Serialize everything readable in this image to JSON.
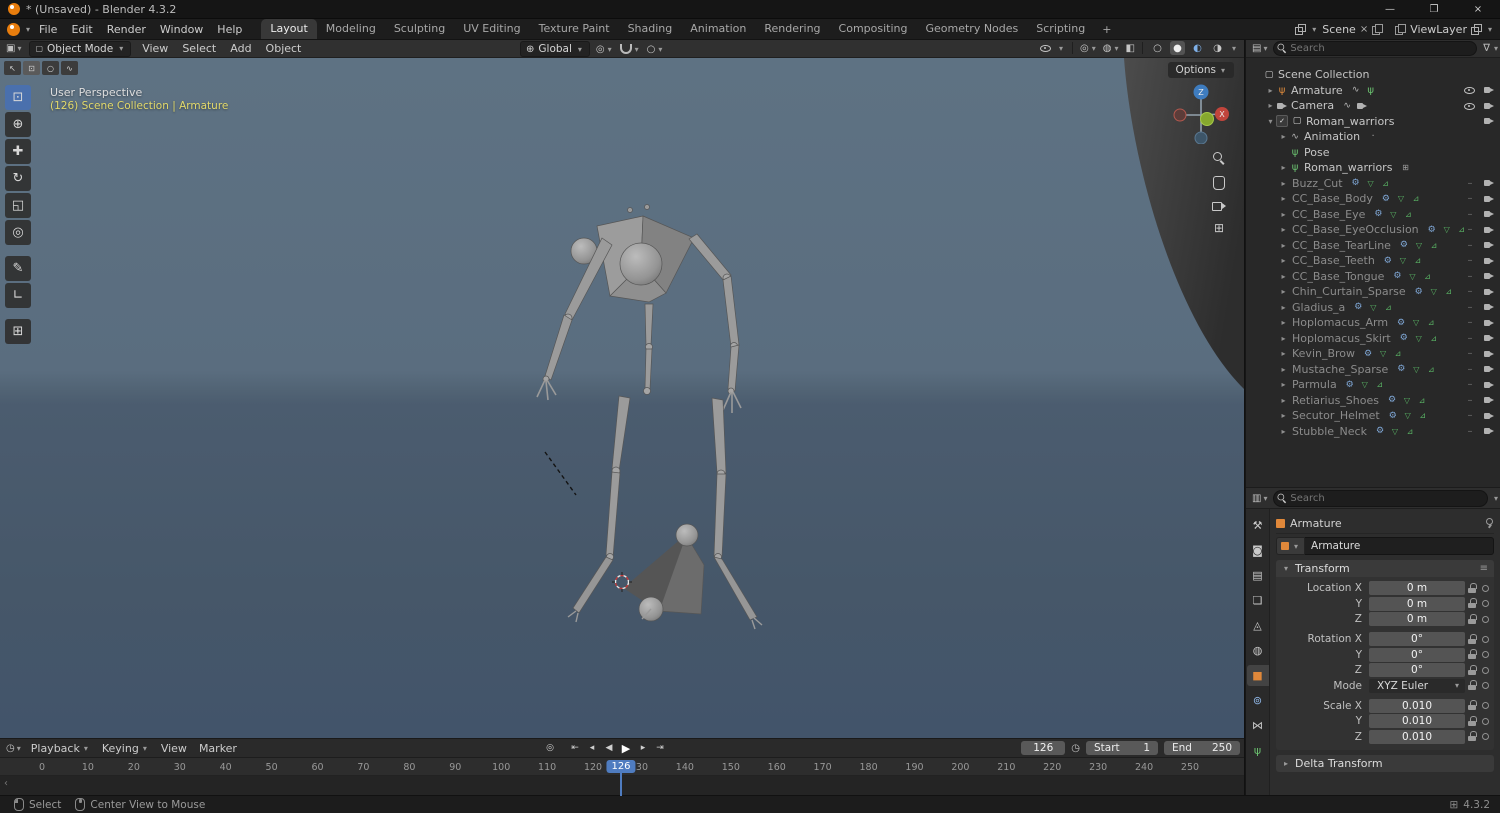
{
  "window": {
    "title": "* (Unsaved) - Blender 4.3.2"
  },
  "titlebar_buttons": [
    {
      "name": "minimize",
      "glyph": "—"
    },
    {
      "name": "maximize",
      "glyph": "❐"
    },
    {
      "name": "close",
      "glyph": "×"
    }
  ],
  "topbar": {
    "menus": [
      "File",
      "Edit",
      "Render",
      "Window",
      "Help"
    ],
    "workspaces": [
      "Layout",
      "Modeling",
      "Sculpting",
      "UV Editing",
      "Texture Paint",
      "Shading",
      "Animation",
      "Rendering",
      "Compositing",
      "Geometry Nodes",
      "Scripting"
    ],
    "active_workspace": "Layout",
    "add_tab": "+",
    "scene_label": "Scene",
    "viewlayer_label": "ViewLayer"
  },
  "vp_header": {
    "mode_label": "Object Mode",
    "menus": [
      "View",
      "Select",
      "Add",
      "Object"
    ],
    "orientation_label": "Global"
  },
  "viewport": {
    "persp_label": "User Perspective",
    "context_label": "(126) Scene Collection | Armature",
    "options_label": "Options",
    "gizmo_z": "Z",
    "gizmo_x": "X"
  },
  "tools": [
    {
      "name": "select-box",
      "glyph": "⊡",
      "active": true
    },
    {
      "name": "cursor",
      "glyph": "⊕"
    },
    {
      "name": "move",
      "glyph": "✚"
    },
    {
      "name": "rotate",
      "glyph": "↻"
    },
    {
      "name": "scale",
      "glyph": "◱"
    },
    {
      "name": "transform",
      "glyph": "◎"
    },
    {
      "name": "annotate",
      "glyph": "✎"
    },
    {
      "name": "measure",
      "glyph": "∟"
    },
    {
      "name": "add-cube",
      "glyph": "⊞"
    }
  ],
  "select_modes": [
    {
      "name": "tweak",
      "glyph": "↖"
    },
    {
      "name": "select-box",
      "glyph": "⊡",
      "active": true
    },
    {
      "name": "select-circle",
      "glyph": "○"
    },
    {
      "name": "select-lasso",
      "glyph": "∿"
    }
  ],
  "icon_glyphs": {
    "collection": "▢",
    "armature": "ψ",
    "armature-g": "ψ",
    "pose": "ψ",
    "action": "∿",
    "modifier": "⚙",
    "mesh": "▽",
    "vgroup": "⊿",
    "dash": "–",
    "dot": "·",
    "grid": "⊞",
    "check": "✓"
  },
  "icons": {
    "chev": "▾",
    "arrow_r": "▸",
    "burger": "≡",
    "funnel": "∇",
    "editor_outliner": "▤",
    "editor_props": "▥",
    "editor_3d": "▣",
    "editor_timeline": "◷",
    "globe": "⊕",
    "pivot": "◎",
    "prop_circle": "○",
    "vis_gizmo": "◎",
    "vis_overlay": "◍",
    "xray": "◧",
    "shade_wire": "○",
    "shade_solid": "●",
    "shade_mat": "◐",
    "shade_render": "◑",
    "scroll_left": "‹",
    "grid": "⊞",
    "obj_sq": "▢",
    "clock": "◷",
    "unlink": "×"
  },
  "outliner": {
    "search_placeholder": "Search",
    "rows": [
      {
        "label": "Scene Collection",
        "depth": 0,
        "icon": "collection",
        "arrow": ""
      },
      {
        "label": "Armature",
        "depth": 1,
        "icon": "armature",
        "arrow": "right",
        "after": [
          "action",
          "pose"
        ],
        "right": [
          "eye",
          "cam"
        ]
      },
      {
        "label": "Camera",
        "depth": 1,
        "icon": "cam",
        "arrow": "right",
        "after": [
          "action",
          "cam"
        ],
        "right": [
          "eye",
          "cam"
        ]
      },
      {
        "label": "Roman_warriors",
        "depth": 1,
        "icon": "collection",
        "arrow": "down",
        "checkbox": true,
        "right": [
          "cam"
        ]
      },
      {
        "label": "Animation",
        "depth": 2,
        "icon": "action",
        "arrow": "right",
        "after": [
          "dot"
        ]
      },
      {
        "label": "Pose",
        "depth": 2,
        "icon": "pose",
        "arrow": ""
      },
      {
        "label": "Roman_warriors",
        "depth": 2,
        "icon": "armature-g",
        "arrow": "right",
        "after": [
          "grid"
        ]
      },
      {
        "label": "Buzz_Cut",
        "depth": 2,
        "arrow": "right",
        "after": [
          "modifier",
          "mesh",
          "vgroup"
        ],
        "right": [
          "dash",
          "cam"
        ],
        "dim": true
      },
      {
        "label": "CC_Base_Body",
        "depth": 2,
        "arrow": "right",
        "after": [
          "modifier",
          "mesh",
          "vgroup"
        ],
        "right": [
          "dash",
          "cam"
        ],
        "dim": true
      },
      {
        "label": "CC_Base_Eye",
        "depth": 2,
        "arrow": "right",
        "after": [
          "modifier",
          "mesh",
          "vgroup"
        ],
        "right": [
          "dash",
          "cam"
        ],
        "dim": true
      },
      {
        "label": "CC_Base_EyeOcclusion",
        "depth": 2,
        "arrow": "right",
        "after": [
          "modifier",
          "mesh",
          "vgroup"
        ],
        "right": [
          "dash",
          "cam"
        ],
        "dim": true
      },
      {
        "label": "CC_Base_TearLine",
        "depth": 2,
        "arrow": "right",
        "after": [
          "modifier",
          "mesh",
          "vgroup"
        ],
        "right": [
          "dash",
          "cam"
        ],
        "dim": true
      },
      {
        "label": "CC_Base_Teeth",
        "depth": 2,
        "arrow": "right",
        "after": [
          "modifier",
          "mesh",
          "vgroup"
        ],
        "right": [
          "dash",
          "cam"
        ],
        "dim": true
      },
      {
        "label": "CC_Base_Tongue",
        "depth": 2,
        "arrow": "right",
        "after": [
          "modifier",
          "mesh",
          "vgroup"
        ],
        "right": [
          "dash",
          "cam"
        ],
        "dim": true
      },
      {
        "label": "Chin_Curtain_Sparse",
        "depth": 2,
        "arrow": "right",
        "after": [
          "modifier",
          "mesh",
          "vgroup"
        ],
        "right": [
          "dash",
          "cam"
        ],
        "dim": true
      },
      {
        "label": "Gladius_a",
        "depth": 2,
        "arrow": "right",
        "after": [
          "modifier",
          "mesh",
          "vgroup"
        ],
        "right": [
          "dash",
          "cam"
        ],
        "dim": true
      },
      {
        "label": "Hoplomacus_Arm",
        "depth": 2,
        "arrow": "right",
        "after": [
          "modifier",
          "mesh",
          "vgroup"
        ],
        "right": [
          "dash",
          "cam"
        ],
        "dim": true
      },
      {
        "label": "Hoplomacus_Skirt",
        "depth": 2,
        "arrow": "right",
        "after": [
          "modifier",
          "mesh",
          "vgroup"
        ],
        "right": [
          "dash",
          "cam"
        ],
        "dim": true
      },
      {
        "label": "Kevin_Brow",
        "depth": 2,
        "arrow": "right",
        "after": [
          "modifier",
          "mesh",
          "vgroup"
        ],
        "right": [
          "dash",
          "cam"
        ],
        "dim": true
      },
      {
        "label": "Mustache_Sparse",
        "depth": 2,
        "arrow": "right",
        "after": [
          "modifier",
          "mesh",
          "vgroup"
        ],
        "right": [
          "dash",
          "cam"
        ],
        "dim": true
      },
      {
        "label": "Parmula",
        "depth": 2,
        "arrow": "right",
        "after": [
          "modifier",
          "mesh",
          "vgroup"
        ],
        "right": [
          "dash",
          "cam"
        ],
        "dim": true
      },
      {
        "label": "Retiarius_Shoes",
        "depth": 2,
        "arrow": "right",
        "after": [
          "modifier",
          "mesh",
          "vgroup"
        ],
        "right": [
          "dash",
          "cam"
        ],
        "dim": true
      },
      {
        "label": "Secutor_Helmet",
        "depth": 2,
        "arrow": "right",
        "after": [
          "modifier",
          "mesh",
          "vgroup"
        ],
        "right": [
          "dash",
          "cam"
        ],
        "dim": true
      },
      {
        "label": "Stubble_Neck",
        "depth": 2,
        "arrow": "right",
        "after": [
          "modifier",
          "mesh",
          "vgroup"
        ],
        "right": [
          "dash",
          "cam"
        ],
        "dim": true
      }
    ]
  },
  "properties": {
    "search_placeholder": "Search",
    "breadcrumb_object": "Armature",
    "name_value": "Armature",
    "tabs": [
      {
        "name": "tool",
        "glyph": "⚒"
      },
      {
        "name": "render",
        "glyph": "◙"
      },
      {
        "name": "output",
        "glyph": "▤"
      },
      {
        "name": "view-layer",
        "glyph": "❏"
      },
      {
        "name": "scene",
        "glyph": "◬"
      },
      {
        "name": "world",
        "glyph": "◍"
      },
      {
        "name": "object",
        "glyph": "■",
        "active": true,
        "color": "#e0883a"
      },
      {
        "name": "physics",
        "glyph": "⊚",
        "color": "#8fb6e6"
      },
      {
        "name": "constraints",
        "glyph": "⋈"
      },
      {
        "name": "object-data",
        "glyph": "ψ",
        "color": "#6ac06f"
      }
    ],
    "transform": {
      "title": "Transform",
      "rows": [
        {
          "label": "Location X",
          "value": "0 m",
          "group": 1
        },
        {
          "label": "Y",
          "value": "0 m",
          "group": 1
        },
        {
          "label": "Z",
          "value": "0 m",
          "group": 1
        },
        {
          "label": "Rotation X",
          "value": "0°",
          "group": 2
        },
        {
          "label": "Y",
          "value": "0°",
          "group": 2
        },
        {
          "label": "Z",
          "value": "0°",
          "group": 2
        },
        {
          "label": "Mode",
          "value": "XYZ Euler",
          "group": 2,
          "kind": "select"
        },
        {
          "label": "Scale X",
          "value": "0.010",
          "group": 3
        },
        {
          "label": "Y",
          "value": "0.010",
          "group": 3
        },
        {
          "label": "Z",
          "value": "0.010",
          "group": 3
        }
      ]
    },
    "delta_title": "Delta Transform"
  },
  "timeline": {
    "menus": [
      "Playback",
      "Keying",
      "View",
      "Marker"
    ],
    "transport": [
      {
        "name": "auto-key",
        "glyph": "◎"
      },
      {
        "name": "jump-start",
        "glyph": "⇤"
      },
      {
        "name": "prev-key",
        "glyph": "◂"
      },
      {
        "name": "play-reverse",
        "glyph": "◀"
      },
      {
        "name": "play",
        "glyph": "▶"
      },
      {
        "name": "next-key",
        "glyph": "▸"
      },
      {
        "name": "jump-end",
        "glyph": "⇥"
      }
    ],
    "current_frame": "126",
    "start_label": "Start",
    "start_value": "1",
    "end_label": "End",
    "end_value": "250",
    "ticks": [
      "0",
      "10",
      "20",
      "30",
      "40",
      "50",
      "60",
      "70",
      "80",
      "90",
      "100",
      "110",
      "120",
      "130",
      "140",
      "150",
      "160",
      "170",
      "180",
      "190",
      "200",
      "210",
      "220",
      "230",
      "240",
      "250"
    ]
  },
  "statusbar": {
    "select_label": "Select",
    "center_label": "Center View to Mouse",
    "version": "4.3.2"
  }
}
